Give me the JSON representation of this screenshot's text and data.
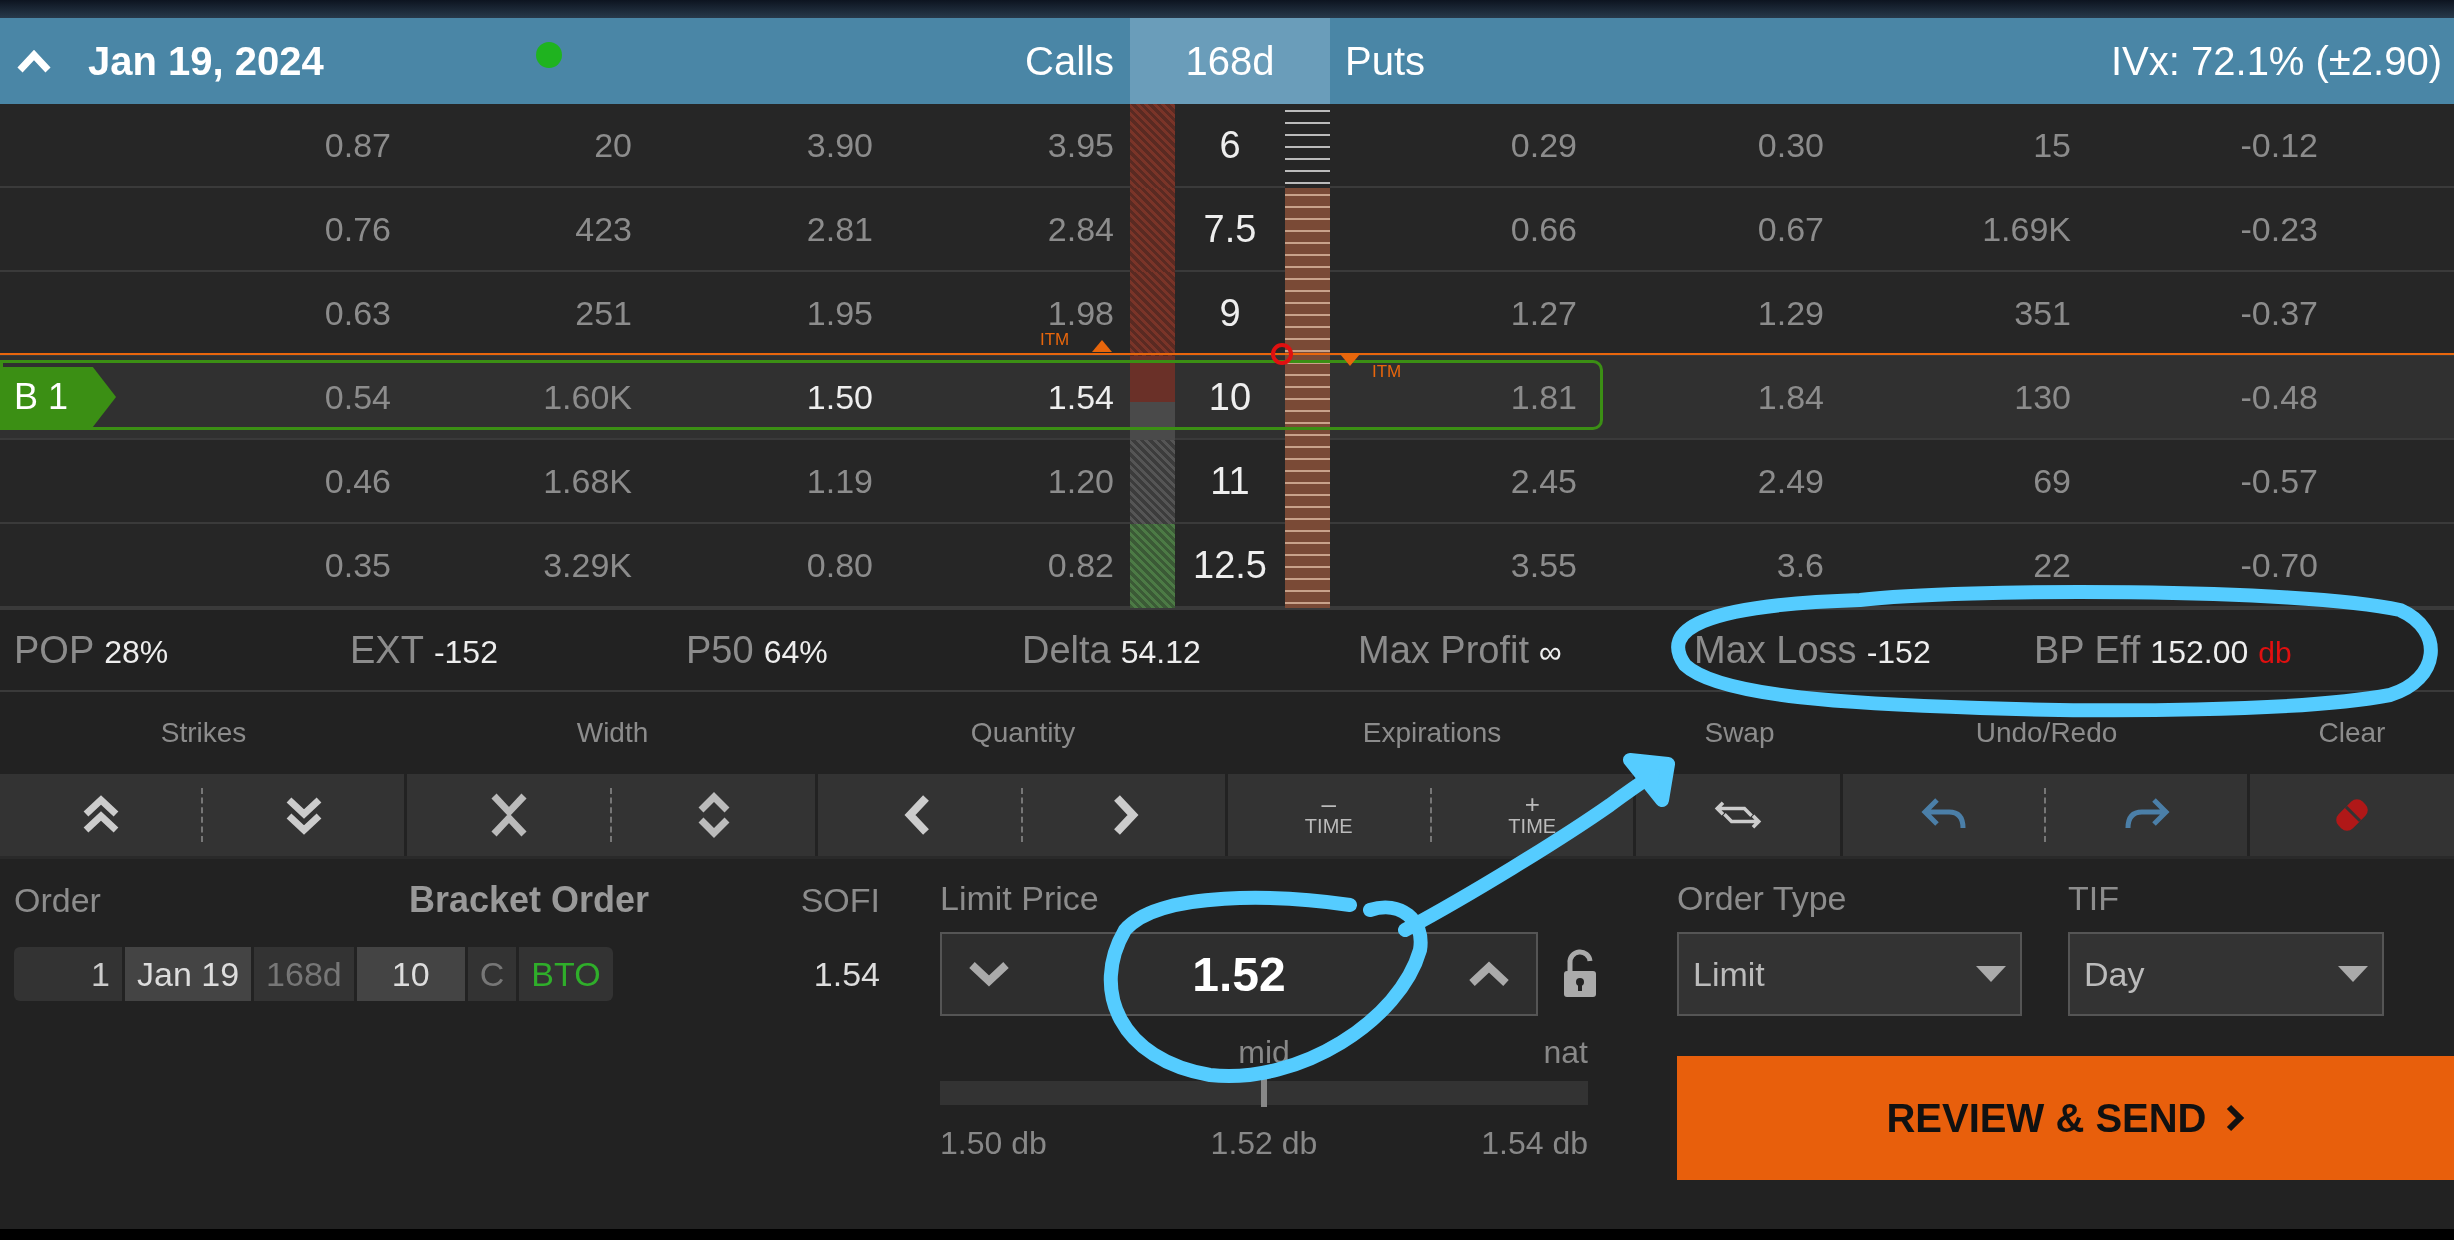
{
  "header": {
    "date": "Jan 19, 2024",
    "calls_label": "Calls",
    "days": "168d",
    "puts_label": "Puts",
    "ivx": "IVx: 72.1% (±2.90)"
  },
  "chain": {
    "itm_calls": "ITM",
    "itm_puts": "ITM",
    "rows": [
      {
        "calls": [
          "0.87",
          "20",
          "3.90",
          "3.95"
        ],
        "strike": "6",
        "puts": [
          "0.29",
          "0.30",
          "15",
          "-0.12"
        ],
        "kind": "itm",
        "in_range": false,
        "itm_boundary": false,
        "selected": false
      },
      {
        "calls": [
          "0.76",
          "423",
          "2.81",
          "2.84"
        ],
        "strike": "7.5",
        "puts": [
          "0.66",
          "0.67",
          "1.69K",
          "-0.23"
        ],
        "kind": "itm",
        "in_range": true,
        "itm_boundary": false,
        "selected": false
      },
      {
        "calls": [
          "0.63",
          "251",
          "1.95",
          "1.98"
        ],
        "strike": "9",
        "puts": [
          "1.27",
          "1.29",
          "351",
          "-0.37"
        ],
        "kind": "itm",
        "in_range": true,
        "itm_boundary": false,
        "selected": false
      },
      {
        "leg": "B 1",
        "calls": [
          "0.54",
          "1.60K",
          "1.50",
          "1.54"
        ],
        "strike": "10",
        "puts": [
          "1.81",
          "1.84",
          "130",
          "-0.48"
        ],
        "kind": "atm",
        "in_range": true,
        "itm_boundary": true,
        "selected": true
      },
      {
        "calls": [
          "0.46",
          "1.68K",
          "1.19",
          "1.20"
        ],
        "strike": "11",
        "puts": [
          "2.45",
          "2.49",
          "69",
          "-0.57"
        ],
        "kind": "otm",
        "in_range": true,
        "itm_boundary": false,
        "selected": false
      },
      {
        "calls": [
          "0.35",
          "3.29K",
          "0.80",
          "0.82"
        ],
        "strike": "12.5",
        "puts": [
          "3.55",
          "3.6",
          "22",
          "-0.70"
        ],
        "kind": "far-otm",
        "in_range": true,
        "itm_boundary": false,
        "selected": false
      }
    ]
  },
  "stats": [
    {
      "label": "POP",
      "value": "28%"
    },
    {
      "label": "EXT",
      "value": "-152"
    },
    {
      "label": "P50",
      "value": "64%"
    },
    {
      "label": "Delta",
      "value": "54.12"
    },
    {
      "label": "Max Profit",
      "value": "∞"
    },
    {
      "label": "Max Loss",
      "value": "-152"
    },
    {
      "label": "BP Eff",
      "value": "152.00",
      "suffix": "db"
    }
  ],
  "toolbar": [
    {
      "label": "Strikes",
      "buttons": [
        {
          "kind": "double-up"
        },
        {
          "kind": "double-down"
        }
      ]
    },
    {
      "label": "Width",
      "buttons": [
        {
          "kind": "narrow"
        },
        {
          "kind": "widen"
        }
      ]
    },
    {
      "label": "Quantity",
      "buttons": [
        {
          "kind": "left"
        },
        {
          "kind": "right"
        }
      ]
    },
    {
      "label": "Expirations",
      "buttons": [
        {
          "kind": "text",
          "sign": "–",
          "text": "TIME"
        },
        {
          "kind": "text",
          "sign": "+",
          "text": "TIME"
        }
      ]
    },
    {
      "label": "Swap",
      "buttons": [
        {
          "kind": "swap"
        }
      ]
    },
    {
      "label": "Undo/Redo",
      "buttons": [
        {
          "kind": "undo"
        },
        {
          "kind": "redo"
        }
      ]
    },
    {
      "label": "Clear",
      "buttons": [
        {
          "kind": "clear"
        }
      ]
    }
  ],
  "order": {
    "label": "Order",
    "title": "Bracket Order",
    "symbol": "SOFI",
    "symbol_price": "1.54",
    "legs": [
      {
        "text": "1",
        "kind": "qty"
      },
      {
        "text": "Jan 19",
        "kind": "date"
      },
      {
        "text": "168d",
        "kind": "dim"
      },
      {
        "text": "10",
        "kind": "strike"
      },
      {
        "text": "C",
        "kind": "dim"
      },
      {
        "text": "BTO",
        "kind": "action"
      }
    ]
  },
  "limit": {
    "label": "Limit Price",
    "value": "1.52",
    "mid": "mid",
    "nat": "nat",
    "level": 0.5,
    "ticks": [
      "1.50 db",
      "1.52 db",
      "1.54 db"
    ]
  },
  "order_type": {
    "label": "Order Type",
    "value": "Limit"
  },
  "tif": {
    "label": "TIF",
    "value": "Day"
  },
  "review": "REVIEW & SEND"
}
